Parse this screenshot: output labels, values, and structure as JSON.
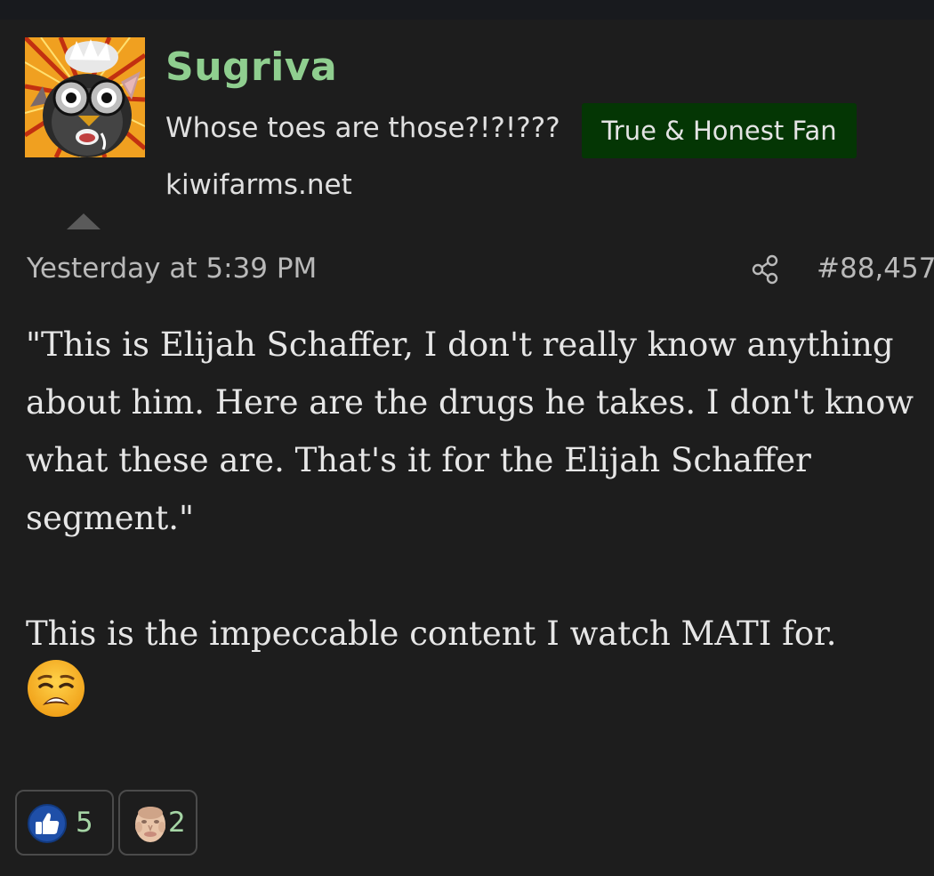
{
  "user": {
    "name": "Sugriva",
    "title": "Whose toes are those?!?!???",
    "banner": "True & Honest Fan",
    "site": "kiwifarms.net",
    "avatar_icon": "furby-avatar-icon"
  },
  "post": {
    "date": "Yesterday at 5:39 PM",
    "number": "#88,457",
    "paragraph1": "\"This is Elijah Schaffer, I don't really know anything about him. Here are the drugs he takes. I don't know what these are. That's it for the Elijah Schaffer segment.\"",
    "paragraph2": "This is the impeccable content I watch MATI for.",
    "emoji_icon": "weary-face-icon"
  },
  "reactions": [
    {
      "icon": "thumbs-up-icon",
      "count": "5"
    },
    {
      "icon": "face-reaction-icon",
      "count": "2"
    }
  ],
  "colors": {
    "background": "#1d1d1d",
    "username": "#8fce8f",
    "banner_bg": "#043604",
    "reaction_count": "#a5d5a5"
  }
}
